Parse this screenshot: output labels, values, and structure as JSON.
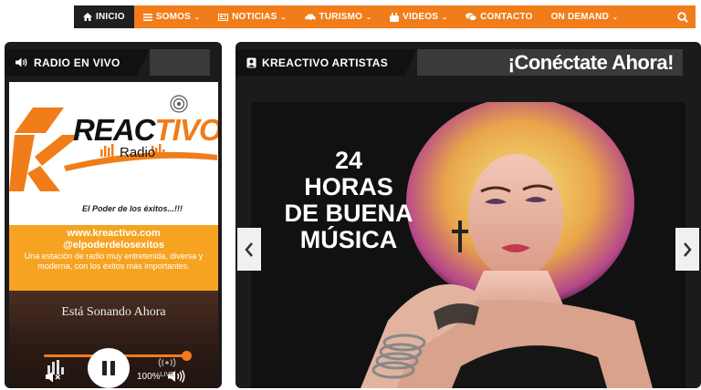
{
  "nav": {
    "items": [
      {
        "label": "INICIO",
        "icon": "home-icon",
        "active": true,
        "caret": false
      },
      {
        "label": "SOMOS",
        "icon": "list-icon",
        "active": false,
        "caret": true
      },
      {
        "label": "NOTICIAS",
        "icon": "newspaper-icon",
        "active": false,
        "caret": true
      },
      {
        "label": "TURISMO",
        "icon": "car-icon",
        "active": false,
        "caret": true
      },
      {
        "label": "VIDEOS",
        "icon": "youtube-icon",
        "active": false,
        "caret": true
      },
      {
        "label": "CONTACTO",
        "icon": "chat-icon",
        "active": false,
        "caret": false
      },
      {
        "label": "ON DEMAND",
        "icon": "",
        "active": false,
        "caret": true
      }
    ],
    "caret_glyph": "⌄",
    "search_icon": "search-icon",
    "accent_color": "#f07d1a"
  },
  "radio": {
    "header": "RADIO EN VIVO",
    "header_icon": "speaker-icon",
    "logo": {
      "brand": "KREACTIVO",
      "sub": "Radio"
    },
    "tagline": "El Poder de los éxitos...!!!",
    "url": "www.kreactivo.com",
    "handle": "@elpoderdelosexitos",
    "description": "Una estación de radio muy entretenida, diversa y moderna, con los éxitos más importantes.",
    "now_playing": "Está Sonando Ahora",
    "progress": 1.0,
    "volume_label": "100%",
    "live_label": "LIVE"
  },
  "artists": {
    "header": "KREACTIVO ARTISTAS",
    "header_icon": "artist-icon",
    "cta": "¡Conéctate Ahora!",
    "headline_lines": [
      "24",
      "HORAS",
      "DE BUENA",
      "MÚSICA"
    ]
  }
}
